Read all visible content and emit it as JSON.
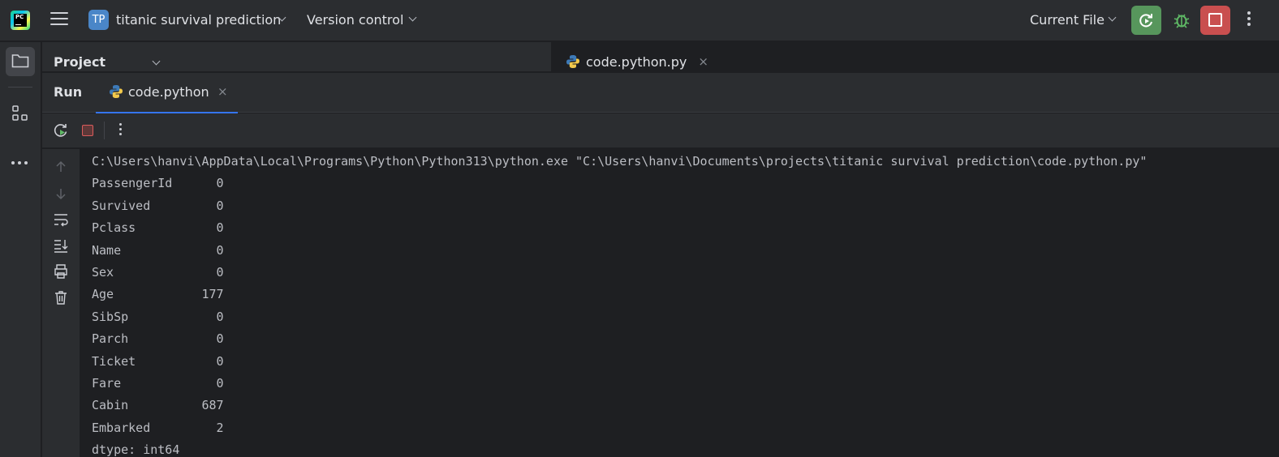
{
  "titlebar": {
    "logo_text": "PC",
    "project_badge": "TP",
    "project_name": "titanic survival prediction",
    "version_control": "Version control",
    "run_config": "Current File",
    "icons": [
      "pycharm-logo-icon",
      "hamburger-menu-icon",
      "chevron-down-icon",
      "rerun-icon",
      "bug-icon",
      "stop-icon",
      "kebab-icon"
    ],
    "accent_run": "#57965c",
    "accent_stop": "#c94f4f"
  },
  "project_panel": {
    "title": "Project"
  },
  "editor": {
    "tabs": [
      {
        "label": "code.python.py",
        "close": "×"
      }
    ]
  },
  "run_panel": {
    "title": "Run",
    "tab_label": "code.python",
    "tab_close": "×",
    "console_lines": [
      "C:\\Users\\hanvi\\AppData\\Local\\Programs\\Python\\Python313\\python.exe \"C:\\Users\\hanvi\\Documents\\projects\\titanic survival prediction\\code.python.py\"",
      "PassengerId      0",
      "Survived         0",
      "Pclass           0",
      "Name             0",
      "Sex              0",
      "Age            177",
      "SibSp            0",
      "Parch            0",
      "Ticket           0",
      "Fare             0",
      "Cabin          687",
      "Embarked         2",
      "dtype: int64"
    ]
  }
}
